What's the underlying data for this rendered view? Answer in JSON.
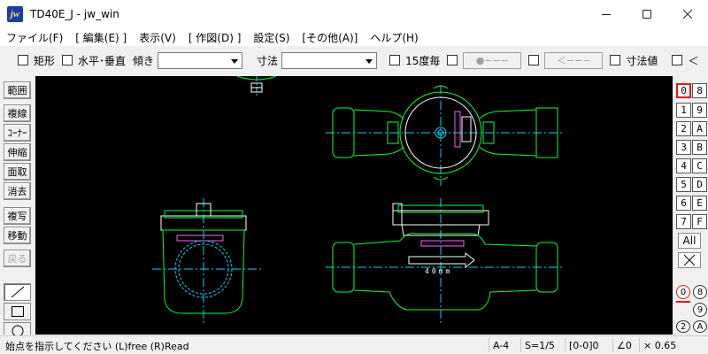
{
  "window": {
    "title": "TD40E_J - jw_win",
    "icon_label": "jw"
  },
  "menu": [
    {
      "label": "ファイル(F)"
    },
    {
      "label": "[ 編集(E) ]"
    },
    {
      "label": "表示(V)"
    },
    {
      "label": "[ 作図(D) ]"
    },
    {
      "label": "設定(S)"
    },
    {
      "label": "[その他(A)]"
    },
    {
      "label": "ヘルプ(H)"
    }
  ],
  "options": {
    "rect": "矩形",
    "horiz_vert": "水平･垂直",
    "angle": "傾き",
    "angle_value": "",
    "dimension": "寸法",
    "dimension_value": "",
    "deg15": "15度毎",
    "btn_dot": "●−−−",
    "btn_arrow": "＜−−−",
    "dim_value": "寸法値",
    "lt": "＜"
  },
  "left_tools": [
    {
      "label": "範囲",
      "disabled": false
    },
    {
      "label": "複線",
      "disabled": false
    },
    {
      "label": "ｺｰﾅｰ",
      "disabled": false
    },
    {
      "label": "伸縮",
      "disabled": false
    },
    {
      "label": "面取",
      "disabled": false
    },
    {
      "label": "消去",
      "disabled": false
    },
    {
      "label": "複写",
      "disabled": false
    },
    {
      "label": "移動",
      "disabled": false
    },
    {
      "label": "戻る",
      "disabled": true
    }
  ],
  "layers": {
    "left": [
      "0",
      "1",
      "2",
      "3",
      "4",
      "5",
      "6",
      "7"
    ],
    "right": [
      "8",
      "9",
      "A",
      "B",
      "C",
      "D",
      "E",
      "F"
    ],
    "active": "0",
    "all": "All",
    "groups_left": [
      "0",
      "2"
    ],
    "groups_right": [
      "8",
      "9",
      "A"
    ]
  },
  "drawing": {
    "label_40mm": "40mm",
    "colors": {
      "outline": "#00ff3c",
      "center": "#00d8ff",
      "hidden": "#00d8ff",
      "magenta": "#ff5cff",
      "white": "#ffffff"
    }
  },
  "status": {
    "message": "始点を指示してください (L)free (R)Read",
    "paper": "A-4",
    "scale": "S=1/5",
    "layer": "[0-0]0",
    "angle": "∠0",
    "zoom": "× 0.65"
  }
}
